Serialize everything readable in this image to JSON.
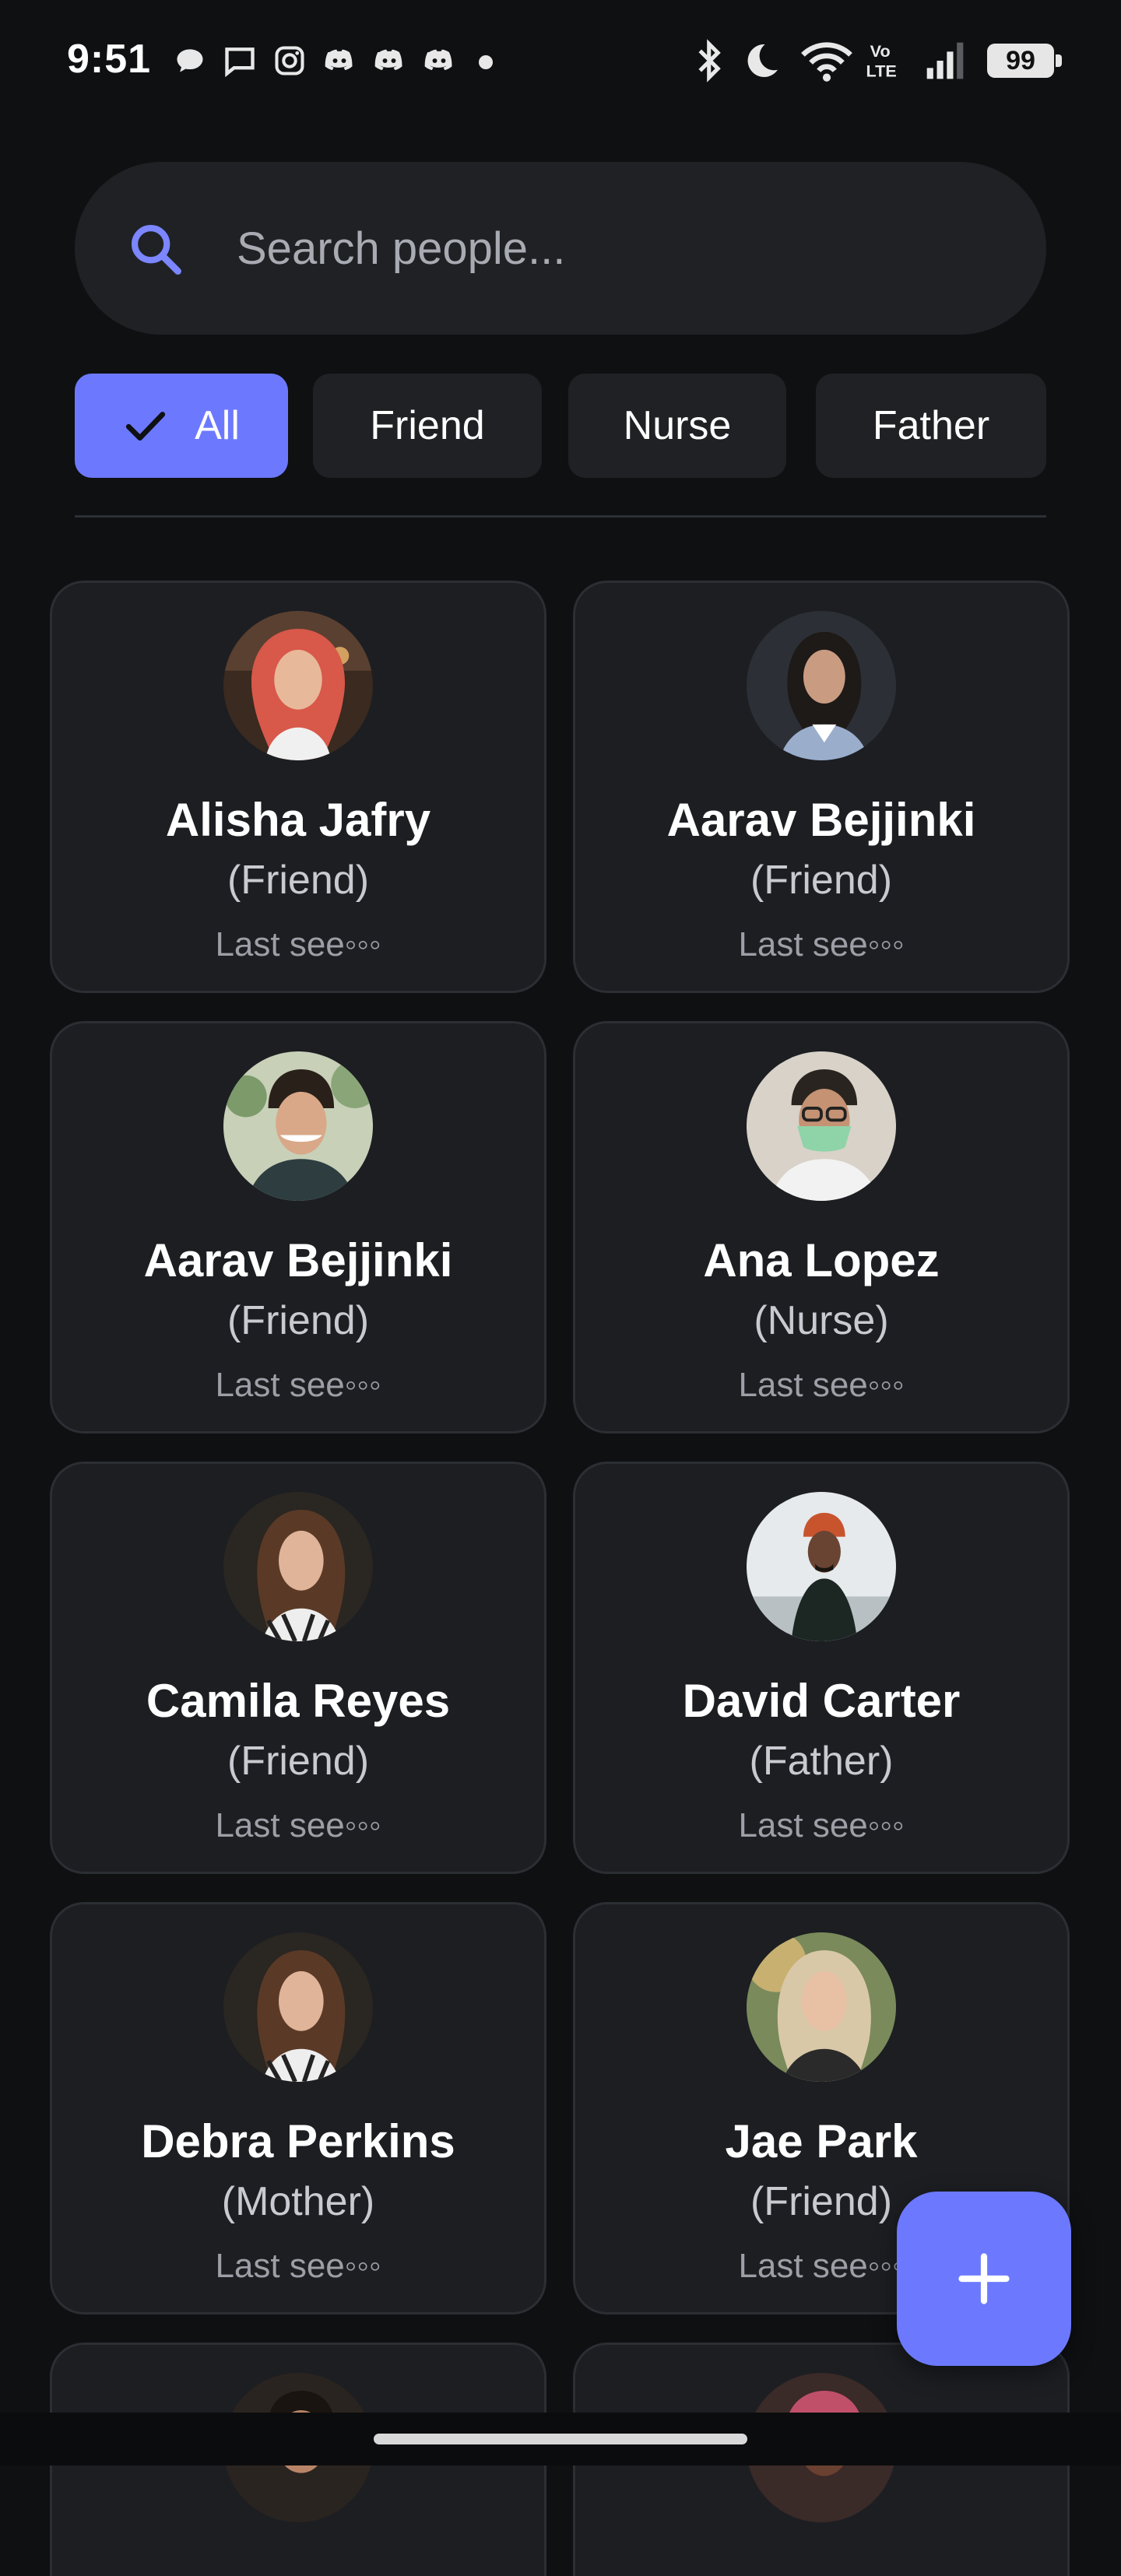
{
  "status_bar": {
    "time": "9:51",
    "battery": "99",
    "notification_icons": [
      "chat-bubble-icon",
      "message-icon",
      "instagram-icon",
      "discord-icon",
      "discord-icon",
      "discord-icon",
      "dot-icon"
    ],
    "system_icons": [
      "bluetooth-icon",
      "moon-icon",
      "wifi-icon",
      "volte-icon",
      "signal-icon",
      "battery-icon"
    ]
  },
  "search": {
    "placeholder": "Search people...",
    "value": ""
  },
  "filters": [
    {
      "label": "All",
      "selected": true
    },
    {
      "label": "Friend",
      "selected": false
    },
    {
      "label": "Nurse",
      "selected": false
    },
    {
      "label": "Father",
      "selected": false
    }
  ],
  "people": [
    {
      "name": "Alisha Jafry",
      "relation": "(Friend)",
      "last_seen": "Last see◦◦◦"
    },
    {
      "name": "Aarav Bejjinki",
      "relation": "(Friend)",
      "last_seen": "Last see◦◦◦"
    },
    {
      "name": "Aarav Bejjinki",
      "relation": "(Friend)",
      "last_seen": "Last see◦◦◦"
    },
    {
      "name": "Ana Lopez",
      "relation": "(Nurse)",
      "last_seen": "Last see◦◦◦"
    },
    {
      "name": "Camila Reyes",
      "relation": "(Friend)",
      "last_seen": "Last see◦◦◦"
    },
    {
      "name": "David Carter",
      "relation": "(Father)",
      "last_seen": "Last see◦◦◦"
    },
    {
      "name": "Debra Perkins",
      "relation": "(Mother)",
      "last_seen": "Last see◦◦◦"
    },
    {
      "name": "Jae Park",
      "relation": "(Friend)",
      "last_seen": "Last see◦◦◦"
    }
  ],
  "colors": {
    "background": "#0f1012",
    "surface": "#1c1e22",
    "accent": "#6c79ff",
    "text_primary": "#ffffff",
    "text_secondary": "#c8cad0",
    "text_muted": "#9c9fa6"
  },
  "fab": {
    "icon": "plus-icon"
  }
}
